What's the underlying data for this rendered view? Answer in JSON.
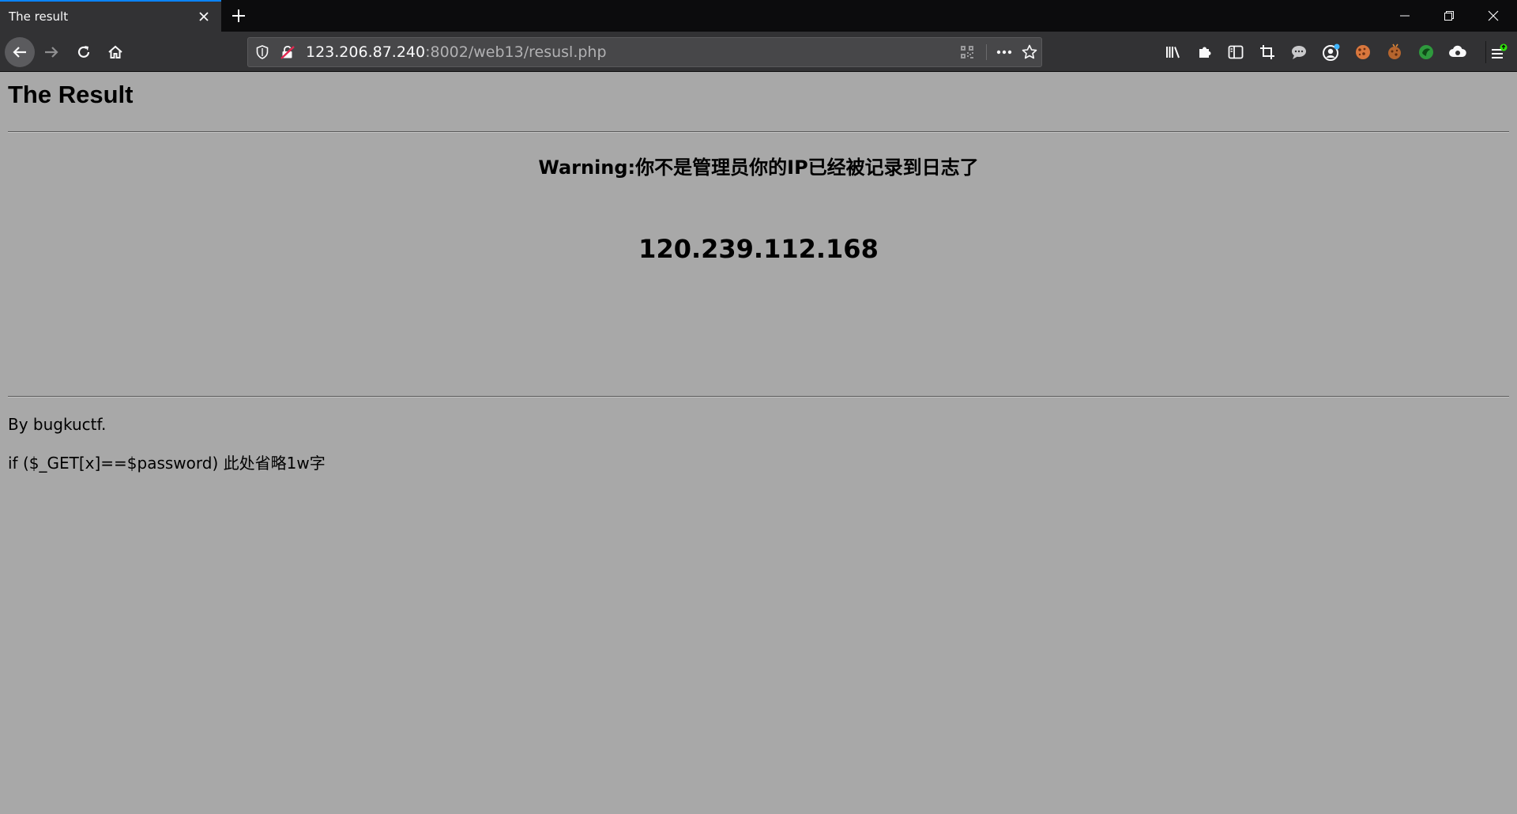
{
  "browser": {
    "tab": {
      "title": "The result"
    },
    "url": {
      "host": "123.206.87.240",
      "rest": ":8002/web13/resusl.php"
    }
  },
  "page": {
    "title": "The Result",
    "warning": "Warning:你不是管理员你的IP已经被记录到日志了",
    "ip": "120.239.112.168",
    "byline": "By bugkuctf.",
    "code_hint": "if ($_GET[x]==$password) 此处省略1w字"
  },
  "colors": {
    "tabstrip": "#0c0c0d",
    "toolbar": "#323234",
    "tab_accent": "#0a84ff",
    "page_background": "#a8a8a8"
  },
  "icons": {
    "tab_close": "close-icon",
    "new_tab": "plus-icon",
    "back": "arrow-left-icon",
    "forward": "arrow-right-icon",
    "reload": "reload-icon",
    "home": "home-icon",
    "tracking": "shield-icon",
    "insecure": "broken-lock-icon",
    "qr": "qr-code-icon",
    "page_actions": "more-icon",
    "bookmark": "star-icon",
    "library": "library-icon",
    "extensions": "puzzle-icon",
    "sidebar": "sidebar-icon",
    "screenshot": "crop-icon",
    "menu": "hamburger-icon"
  }
}
